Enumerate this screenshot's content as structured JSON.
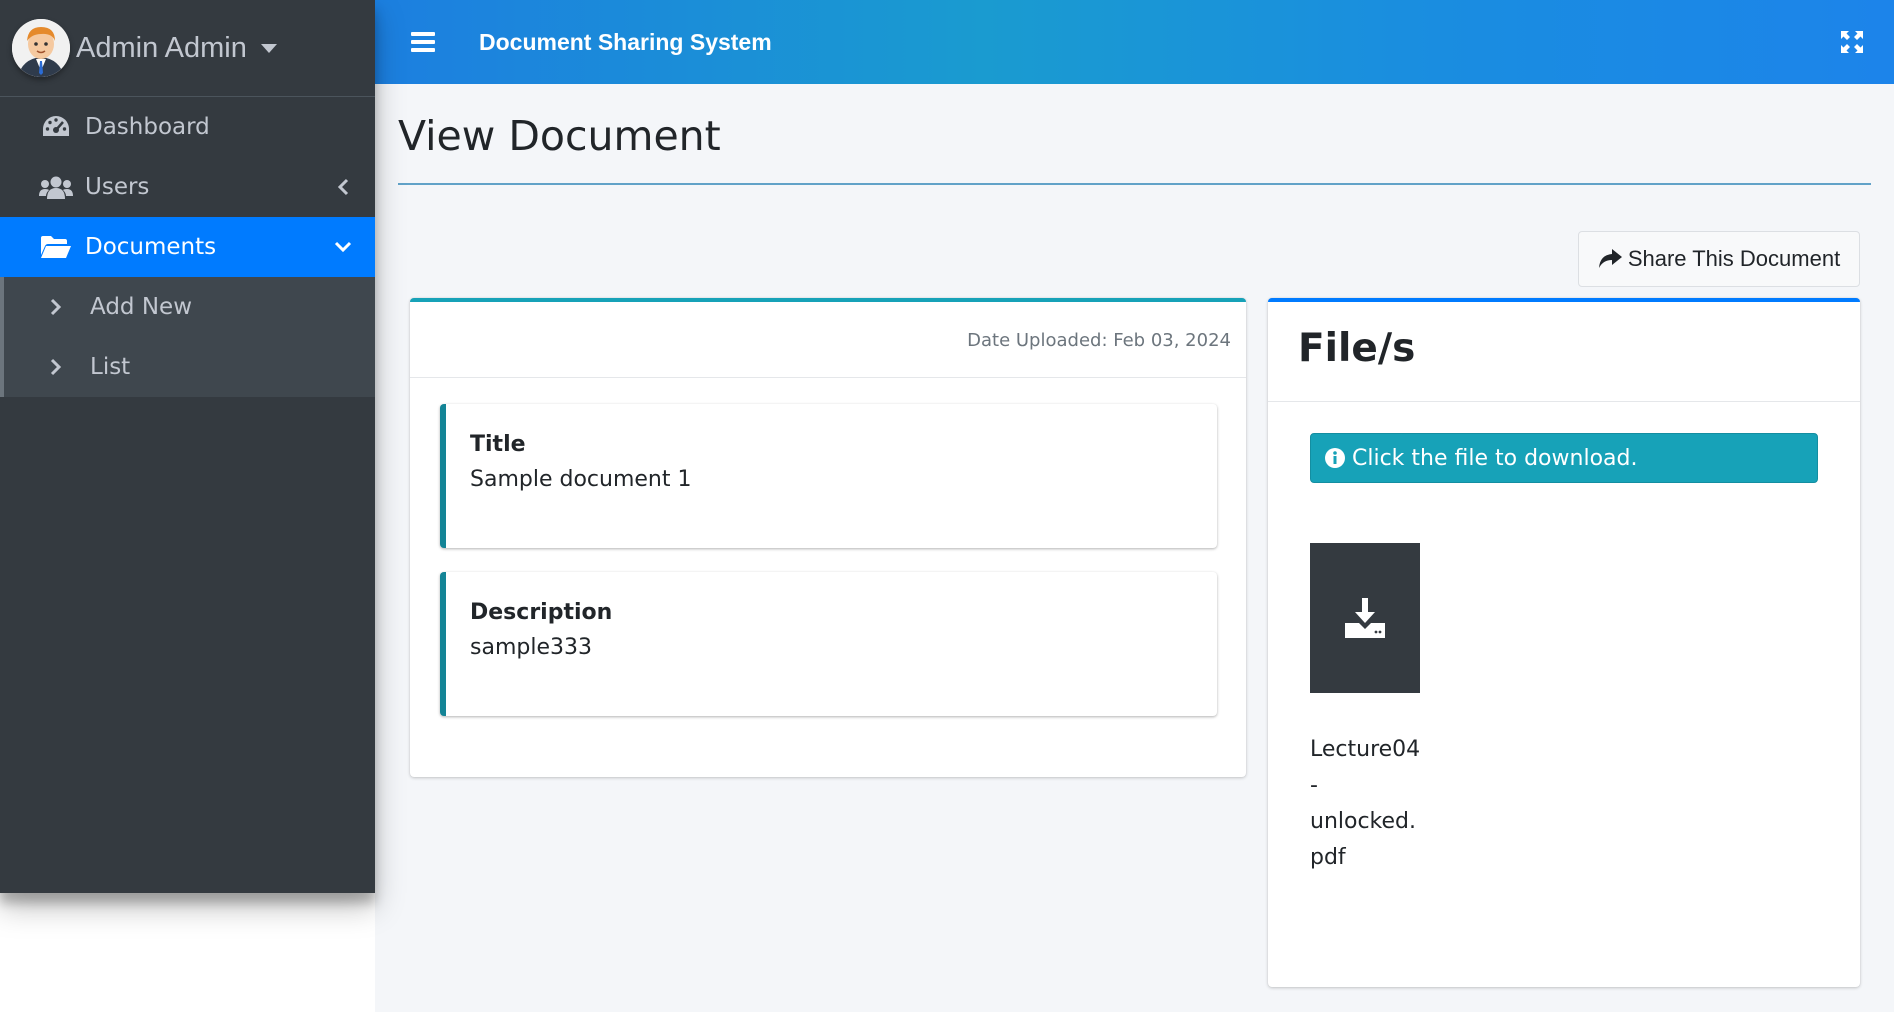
{
  "user": {
    "name": "Admin Admin"
  },
  "sidebar": {
    "items": [
      {
        "label": "Dashboard",
        "icon": "tachometer-icon"
      },
      {
        "label": "Users",
        "icon": "users-icon"
      },
      {
        "label": "Documents",
        "icon": "folder-open-icon",
        "active": true
      }
    ],
    "documents_sub": [
      {
        "label": "Add New",
        "icon": "chevron-right-icon"
      },
      {
        "label": "List",
        "icon": "chevron-right-icon"
      }
    ]
  },
  "header": {
    "brand": "Document Sharing System"
  },
  "page": {
    "title": "View Document"
  },
  "actions": {
    "share_label": "Share This Document"
  },
  "document": {
    "date_uploaded": "Date Uploaded: Feb 03, 2024",
    "title_label": "Title",
    "title_value": "Sample document 1",
    "description_label": "Description",
    "description_value": "sample333"
  },
  "files": {
    "header": "File/s",
    "info": "Click the file to download.",
    "items": [
      {
        "name_lines": [
          "Lecture04",
          "-",
          "unlocked.",
          "pdf"
        ],
        "icon": "download-icon"
      }
    ]
  },
  "colors": {
    "sidebar_bg": "#343a40",
    "accent": "#007bff",
    "info": "#17a2b8",
    "topbar": "#1a9bd0"
  }
}
